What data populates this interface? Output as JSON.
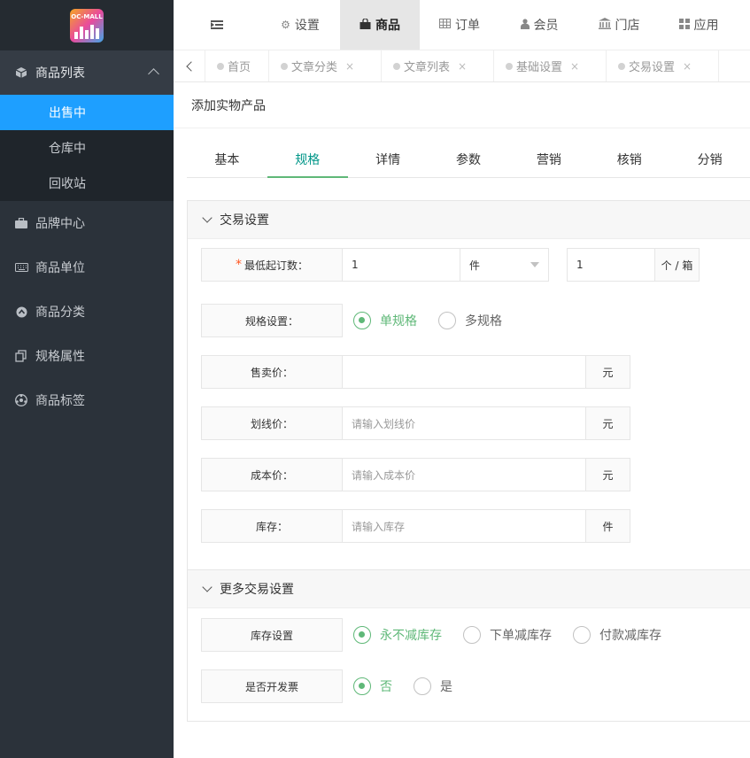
{
  "logo": {
    "text": "OC-MALL"
  },
  "sidebar": {
    "items": [
      {
        "label": "商品列表",
        "icon": "cube-icon"
      },
      {
        "label": "品牌中心",
        "icon": "briefcase-icon"
      },
      {
        "label": "商品单位",
        "icon": "keyboard-icon"
      },
      {
        "label": "商品分类",
        "icon": "circle-arrow-icon"
      },
      {
        "label": "规格属性",
        "icon": "copy-icon"
      },
      {
        "label": "商品标签",
        "icon": "soccer-ball-icon"
      }
    ],
    "sub_items": [
      "出售中",
      "仓库中",
      "回收站"
    ]
  },
  "header": {
    "tabs": [
      {
        "label": "设置",
        "icon": "gears-icon"
      },
      {
        "label": "商品",
        "icon": "shopping-bag-icon"
      },
      {
        "label": "订单",
        "icon": "table-icon"
      },
      {
        "label": "会员",
        "icon": "user-icon"
      },
      {
        "label": "门店",
        "icon": "bank-icon"
      },
      {
        "label": "应用",
        "icon": "grid-icon"
      }
    ]
  },
  "page_tabs": [
    {
      "label": "首页"
    },
    {
      "label": "文章分类",
      "close": "×"
    },
    {
      "label": "文章列表",
      "close": "×"
    },
    {
      "label": "基础设置",
      "close": "×"
    },
    {
      "label": "交易设置",
      "close": "×"
    }
  ],
  "page": {
    "title": "添加实物产品"
  },
  "form_tabs": [
    "基本",
    "规格",
    "详情",
    "参数",
    "营销",
    "核销",
    "分销"
  ],
  "trade": {
    "title": "交易设置",
    "min_order": {
      "label": "最低起订数：",
      "required": "*",
      "value": "1",
      "unit": "件",
      "pack_value": "1",
      "pack_unit": "个 / 箱"
    },
    "spec": {
      "label": "规格设置：",
      "options": [
        "单规格",
        "多规格"
      ]
    },
    "price": {
      "label": "售卖价：",
      "value": "",
      "unit": "元"
    },
    "strike_price": {
      "label": "划线价：",
      "placeholder": "请输入划线价",
      "unit": "元"
    },
    "cost_price": {
      "label": "成本价：",
      "placeholder": "请输入成本价",
      "unit": "元"
    },
    "stock": {
      "label": "库存：",
      "placeholder": "请输入库存",
      "unit": "件"
    }
  },
  "more": {
    "title": "更多交易设置",
    "stock_setting": {
      "label": "库存设置",
      "options": [
        "永不减库存",
        "下单减库存",
        "付款减库存"
      ]
    },
    "invoice": {
      "label": "是否开发票",
      "options": [
        "否",
        "是"
      ]
    }
  },
  "colors": {
    "sidebar_bg": "#2b323a",
    "active_blue": "#1e9fff",
    "accent_green": "#5fb878",
    "tab_green": "#009688",
    "required": "#ff5722"
  }
}
